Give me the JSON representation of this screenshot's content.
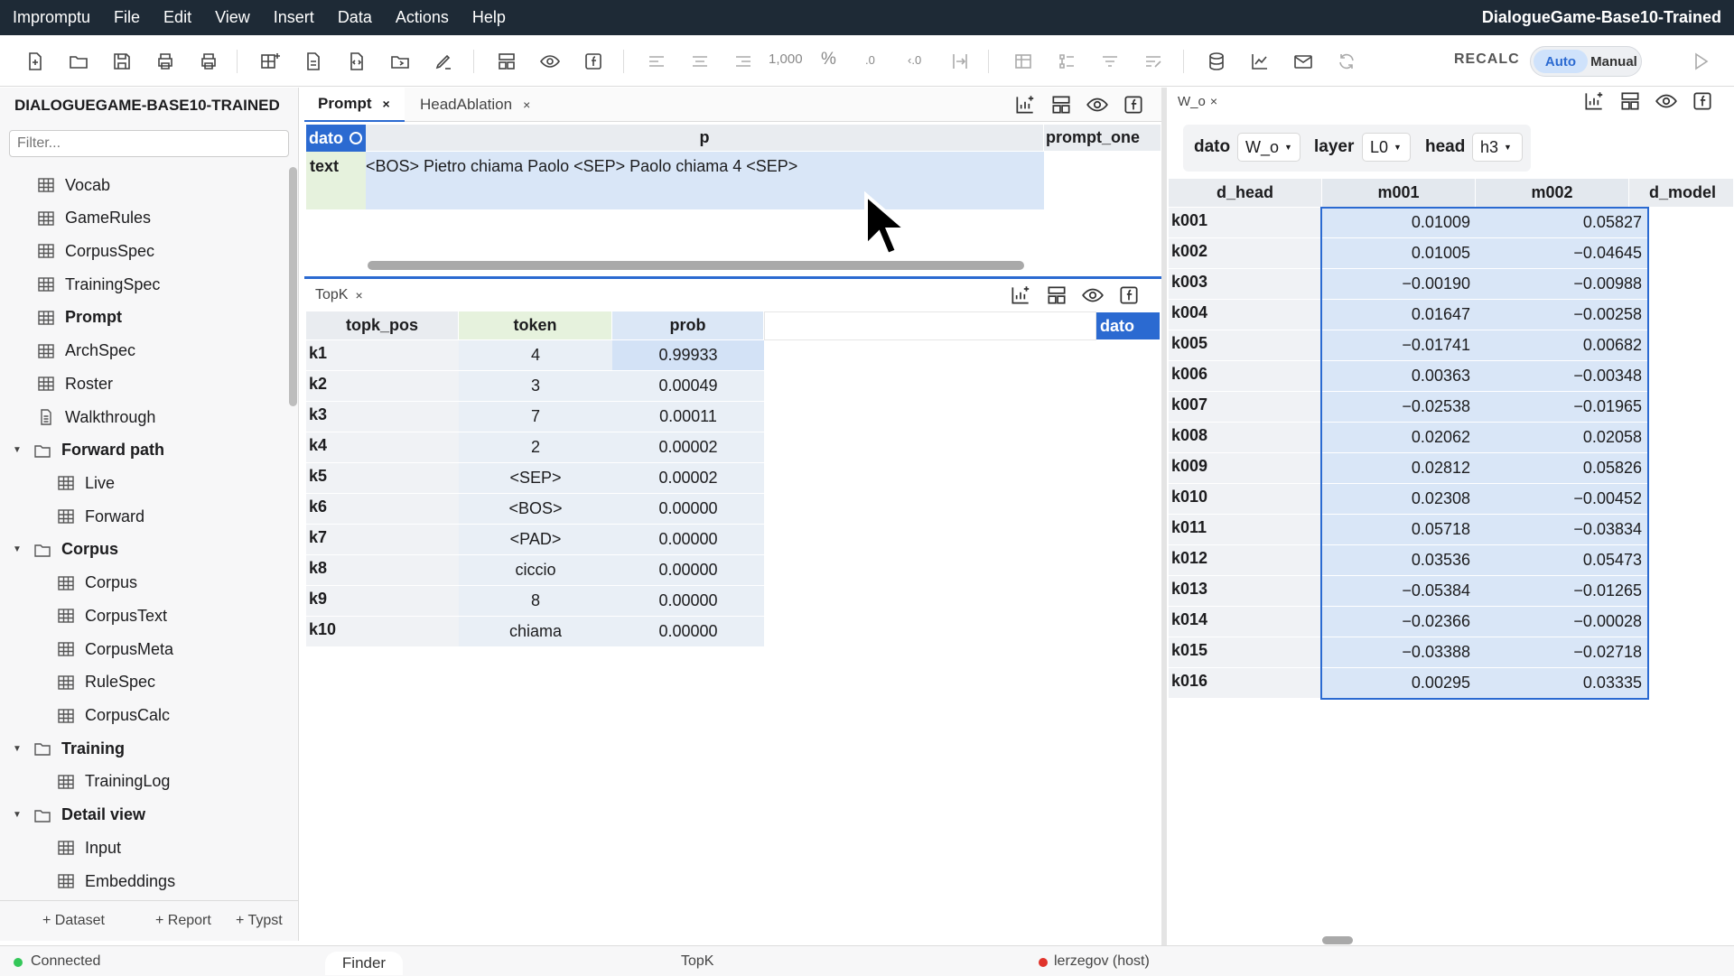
{
  "menubar": {
    "items": [
      "Impromptu",
      "File",
      "Edit",
      "View",
      "Insert",
      "Data",
      "Actions",
      "Help"
    ],
    "window_title": "DialogueGame-Base10-Trained"
  },
  "toolbar": {
    "number_format": "1,000",
    "percent": "%",
    "dec_inc": ".0",
    "dec_dec": ".0",
    "recalc_label": "RECALC",
    "mode_auto": "Auto",
    "mode_manual": "Manual",
    "active_mode": "Auto"
  },
  "sidebar": {
    "title": "DIALOGUEGAME-BASE10-TRAINED",
    "filter_placeholder": "Filter...",
    "items": [
      {
        "label": "Vocab",
        "icon": "table-icon",
        "level": 1
      },
      {
        "label": "GameRules",
        "icon": "table-icon",
        "level": 1
      },
      {
        "label": "CorpusSpec",
        "icon": "table-icon",
        "level": 1
      },
      {
        "label": "TrainingSpec",
        "icon": "table-icon",
        "level": 1
      },
      {
        "label": "Prompt",
        "icon": "table-icon",
        "level": 1,
        "bold": true
      },
      {
        "label": "ArchSpec",
        "icon": "table-icon",
        "level": 1
      },
      {
        "label": "Roster",
        "icon": "table-icon",
        "level": 1
      },
      {
        "label": "Walkthrough",
        "icon": "document-icon",
        "level": 1
      },
      {
        "label": "Forward path",
        "icon": "folder-icon",
        "level": 0,
        "folder": true
      },
      {
        "label": "Live",
        "icon": "table-icon",
        "level": 2
      },
      {
        "label": "Forward",
        "icon": "table-icon",
        "level": 2
      },
      {
        "label": "Corpus",
        "icon": "folder-icon",
        "level": 0,
        "folder": true
      },
      {
        "label": "Corpus",
        "icon": "table-icon",
        "level": 2
      },
      {
        "label": "CorpusText",
        "icon": "table-icon",
        "level": 2
      },
      {
        "label": "CorpusMeta",
        "icon": "table-icon",
        "level": 2
      },
      {
        "label": "RuleSpec",
        "icon": "table-icon",
        "level": 2
      },
      {
        "label": "CorpusCalc",
        "icon": "table-icon",
        "level": 2
      },
      {
        "label": "Training",
        "icon": "folder-icon",
        "level": 0,
        "folder": true
      },
      {
        "label": "TrainingLog",
        "icon": "table-icon",
        "level": 2
      },
      {
        "label": "Detail view",
        "icon": "folder-icon",
        "level": 0,
        "folder": true
      },
      {
        "label": "Input",
        "icon": "table-icon",
        "level": 2
      },
      {
        "label": "Embeddings",
        "icon": "table-icon",
        "level": 2
      }
    ],
    "footer": {
      "dataset": "+ Dataset",
      "report": "+ Report",
      "typst": "+ Typst"
    }
  },
  "prompt_panel": {
    "tabs": [
      {
        "label": "Prompt",
        "active": true
      },
      {
        "label": "HeadAblation",
        "active": false
      }
    ],
    "col_dato": "dato",
    "col_p": "p",
    "col_prompt_one": "prompt_one",
    "row_label": "text",
    "row_value": "<BOS> Pietro chiama Paolo <SEP> Paolo chiama 4 <SEP>"
  },
  "topk_panel": {
    "tab": "TopK",
    "headers": [
      "topk_pos",
      "token",
      "prob"
    ],
    "extra_header": "dato",
    "rows": [
      {
        "k": "k1",
        "token": "4",
        "prob": "0.99933"
      },
      {
        "k": "k2",
        "token": "3",
        "prob": "0.00049"
      },
      {
        "k": "k3",
        "token": "7",
        "prob": "0.00011"
      },
      {
        "k": "k4",
        "token": "2",
        "prob": "0.00002"
      },
      {
        "k": "k5",
        "token": "<SEP>",
        "prob": "0.00002"
      },
      {
        "k": "k6",
        "token": "<BOS>",
        "prob": "0.00000"
      },
      {
        "k": "k7",
        "token": "<PAD>",
        "prob": "0.00000"
      },
      {
        "k": "k8",
        "token": "ciccio",
        "prob": "0.00000"
      },
      {
        "k": "k9",
        "token": "8",
        "prob": "0.00000"
      },
      {
        "k": "k10",
        "token": "chiama",
        "prob": "0.00000"
      }
    ]
  },
  "wo_panel": {
    "tab": "W_o",
    "controls": {
      "dato_label": "dato",
      "dato_value": "W_o",
      "layer_label": "layer",
      "layer_value": "L0",
      "head_label": "head",
      "head_value": "h3"
    },
    "headers": [
      "d_head",
      "m001",
      "m002",
      "d_model"
    ],
    "rows": [
      {
        "k": "k001",
        "m001": "0.01009",
        "m002": "0.05827"
      },
      {
        "k": "k002",
        "m001": "0.01005",
        "m002": "−0.04645"
      },
      {
        "k": "k003",
        "m001": "−0.00190",
        "m002": "−0.00988"
      },
      {
        "k": "k004",
        "m001": "0.01647",
        "m002": "−0.00258"
      },
      {
        "k": "k005",
        "m001": "−0.01741",
        "m002": "0.00682"
      },
      {
        "k": "k006",
        "m001": "0.00363",
        "m002": "−0.00348"
      },
      {
        "k": "k007",
        "m001": "−0.02538",
        "m002": "−0.01965"
      },
      {
        "k": "k008",
        "m001": "0.02062",
        "m002": "0.02058"
      },
      {
        "k": "k009",
        "m001": "0.02812",
        "m002": "0.05826"
      },
      {
        "k": "k010",
        "m001": "0.02308",
        "m002": "−0.00452"
      },
      {
        "k": "k011",
        "m001": "0.05718",
        "m002": "−0.03834"
      },
      {
        "k": "k012",
        "m001": "0.03536",
        "m002": "0.05473"
      },
      {
        "k": "k013",
        "m001": "−0.05384",
        "m002": "−0.01265"
      },
      {
        "k": "k014",
        "m001": "−0.02366",
        "m002": "−0.00028"
      },
      {
        "k": "k015",
        "m001": "−0.03388",
        "m002": "−0.02718"
      },
      {
        "k": "k016",
        "m001": "0.00295",
        "m002": "0.03335"
      }
    ]
  },
  "statusbar": {
    "connection": "Connected",
    "finder": "Finder",
    "active_sheet": "TopK",
    "user": "lerzegov (host)"
  },
  "colors": {
    "menubar_bg": "#1e2a36",
    "accent": "#2b6ad1",
    "selection": "#d9e6f7",
    "connected": "#34c759",
    "user_dot": "#e0332b"
  }
}
